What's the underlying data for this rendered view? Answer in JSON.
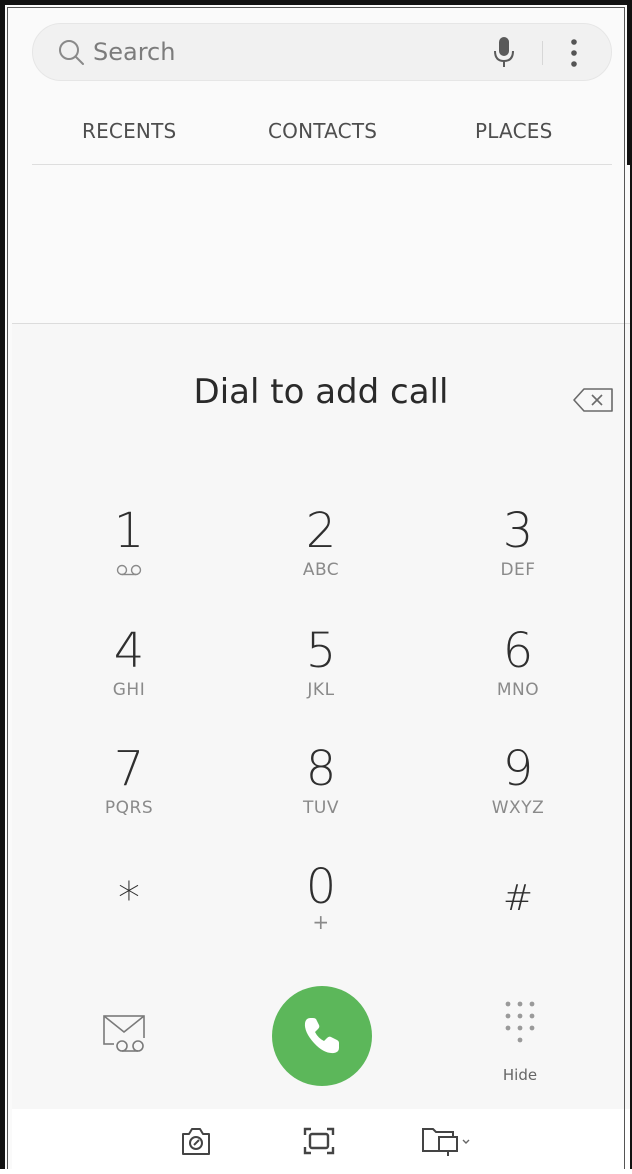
{
  "search": {
    "placeholder": "Search",
    "icons": [
      "search-icon",
      "microphone-icon",
      "more-options-icon"
    ]
  },
  "tabs": [
    {
      "label": "RECENTS"
    },
    {
      "label": "CONTACTS"
    },
    {
      "label": "PLACES"
    }
  ],
  "dialer": {
    "title": "Dial to add call",
    "backspace_icon": "backspace-icon",
    "keys": [
      {
        "digit": "1",
        "letters": "",
        "icon": "voicemail-icon"
      },
      {
        "digit": "2",
        "letters": "ABC"
      },
      {
        "digit": "3",
        "letters": "DEF"
      },
      {
        "digit": "4",
        "letters": "GHI"
      },
      {
        "digit": "5",
        "letters": "JKL"
      },
      {
        "digit": "6",
        "letters": "MNO"
      },
      {
        "digit": "7",
        "letters": "PQRS"
      },
      {
        "digit": "8",
        "letters": "TUV"
      },
      {
        "digit": "9",
        "letters": "WXYZ"
      },
      {
        "digit": "*",
        "letters": ""
      },
      {
        "digit": "0",
        "letters": "+"
      },
      {
        "digit": "#",
        "letters": ""
      }
    ],
    "hide_label": "Hide",
    "call_color": "#5cb75a"
  },
  "system_bar": {
    "icons": [
      "camera-icon",
      "screenshot-icon",
      "multi-window-icon"
    ]
  }
}
